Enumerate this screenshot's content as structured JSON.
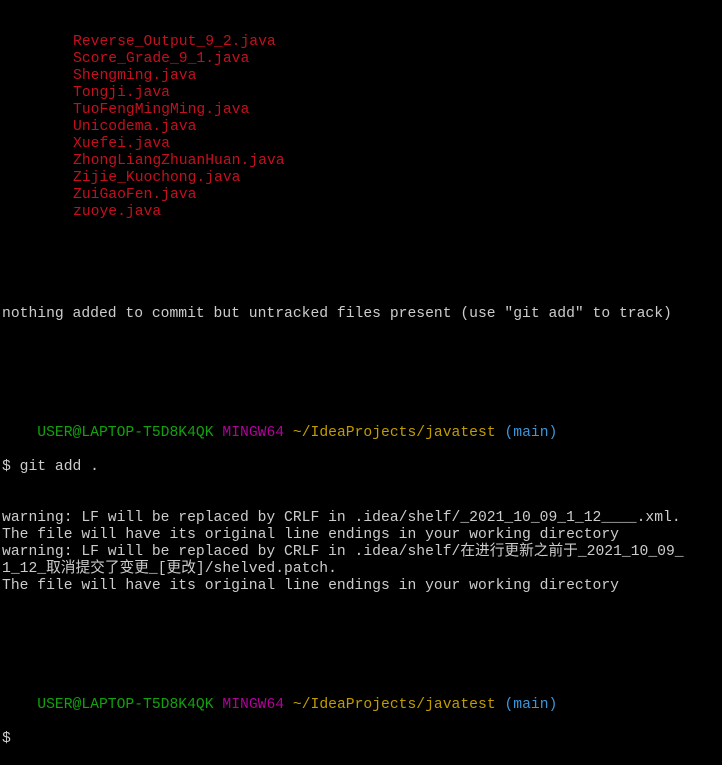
{
  "colors": {
    "untracked": "#c50f1f",
    "user": "#13a10e",
    "system": "#b4009e",
    "path": "#c19c00",
    "branch": "#3a96dd",
    "text": "#cccccc",
    "background": "#000000"
  },
  "untracked_files": [
    "Reverse_Output_9_2.java",
    "Score_Grade_9_1.java",
    "Shengming.java",
    "Tongji.java",
    "TuoFengMingMing.java",
    "Unicodema.java",
    "Xuefei.java",
    "ZhongLiangZhuanHuan.java",
    "Zijie_Kuochong.java",
    "ZuiGaoFen.java",
    "zuoye.java"
  ],
  "status_message": "nothing added to commit but untracked files present (use \"git add\" to track)",
  "prompt": {
    "user": "USER@LAPTOP-T5D8K4QK",
    "system": "MINGW64",
    "path": "~/IdeaProjects/javatest",
    "branch": "(main)",
    "symbol": "$"
  },
  "command": "$ git add .",
  "output": [
    "warning: LF will be replaced by CRLF in .idea/shelf/_2021_10_09_1_12____.xml.",
    "The file will have its original line endings in your working directory",
    "warning: LF will be replaced by CRLF in .idea/shelf/在进行更新之前于_2021_10_09_",
    "1_12_取消提交了变更_[更改]/shelved.patch.",
    "The file will have its original line endings in your working directory"
  ]
}
